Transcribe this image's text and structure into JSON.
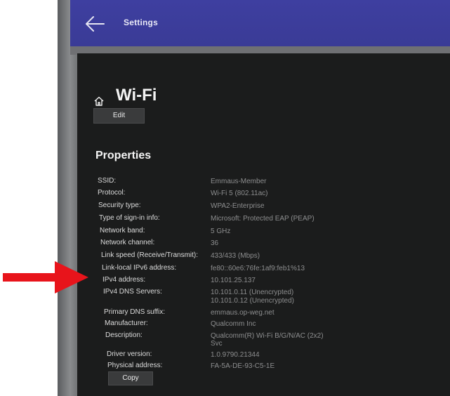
{
  "window": {
    "title": "Settings"
  },
  "page": {
    "title": "Wi-Fi",
    "edit_label": "Edit",
    "section_title": "Properties",
    "copy_label": "Copy"
  },
  "properties": {
    "ssid": {
      "label": "SSID:",
      "value": "Emmaus-Member"
    },
    "protocol": {
      "label": "Protocol:",
      "value": "Wi-Fi 5 (802.11ac)"
    },
    "security": {
      "label": "Security type:",
      "value": "WPA2-Enterprise"
    },
    "signin": {
      "label": "Type of sign-in info:",
      "value": "Microsoft: Protected EAP (PEAP)"
    },
    "band": {
      "label": "Network band:",
      "value": "5 GHz"
    },
    "channel": {
      "label": "Network channel:",
      "value": "36"
    },
    "linkspeed": {
      "label": "Link speed (Receive/Transmit):",
      "value": "433/433 (Mbps)"
    },
    "ipv6": {
      "label": "Link-local IPv6 address:",
      "value": "fe80::60e6:76fe:1af9:feb1%13"
    },
    "ipv4": {
      "label": "IPv4 address:",
      "value": "10.101.25.137"
    },
    "dns": {
      "label": "IPv4 DNS Servers:",
      "value_1": "10.101.0.11 (Unencrypted)",
      "value_2": "10.101.0.12 (Unencrypted)"
    },
    "dnssuffix": {
      "label": "Primary DNS suffix:",
      "value": "emmaus.op-weg.net"
    },
    "manufacturer": {
      "label": "Manufacturer:",
      "value": "Qualcomm Inc"
    },
    "description": {
      "label": "Description:",
      "value_1": "Qualcomm(R) Wi-Fi B/G/N/AC (2x2)",
      "value_2": "Svc"
    },
    "driver": {
      "label": "Driver version:",
      "value": "1.0.9790.21344"
    },
    "mac": {
      "label": "Physical address:",
      "value": "FA-5A-DE-93-C5-1E"
    }
  },
  "colors": {
    "titlebar": "#3e3fa0",
    "panel": "#1b1c1c",
    "label": "#dcdcdc",
    "value": "#8d8e8f",
    "arrow": "#e8141b"
  },
  "icons": {
    "back": "arrow-left-icon",
    "home": "home-icon",
    "annotation": "red-arrow-right"
  }
}
